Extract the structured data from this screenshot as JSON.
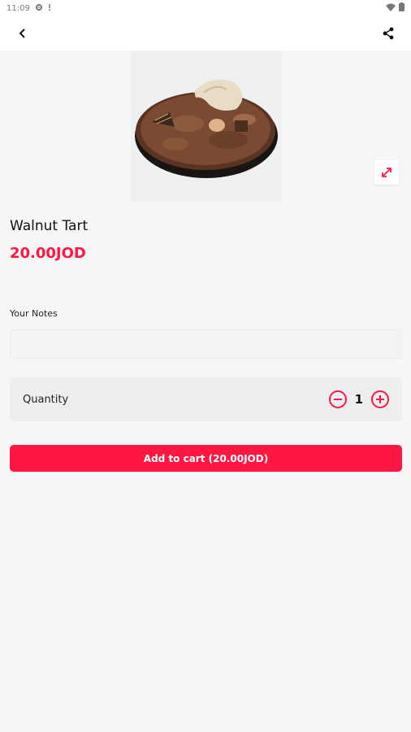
{
  "status_bar": {
    "time": "11:09"
  },
  "product": {
    "name": "Walnut Tart",
    "price": "20.00JOD",
    "image_alt": "Walnut Tart"
  },
  "notes": {
    "label": "Your Notes",
    "value": "",
    "placeholder": ""
  },
  "quantity": {
    "label": "Quantity",
    "value": "1"
  },
  "cart": {
    "button_label": "Add to cart (20.00JOD)"
  },
  "colors": {
    "accent": "#ff1744",
    "background": "#f6f6f6",
    "card": "#eeeef1"
  },
  "icons": [
    "settings-icon",
    "notification-dot-icon",
    "wifi-icon",
    "battery-icon",
    "back-arrow-icon",
    "share-icon",
    "expand-icon",
    "minus-icon",
    "plus-icon"
  ]
}
